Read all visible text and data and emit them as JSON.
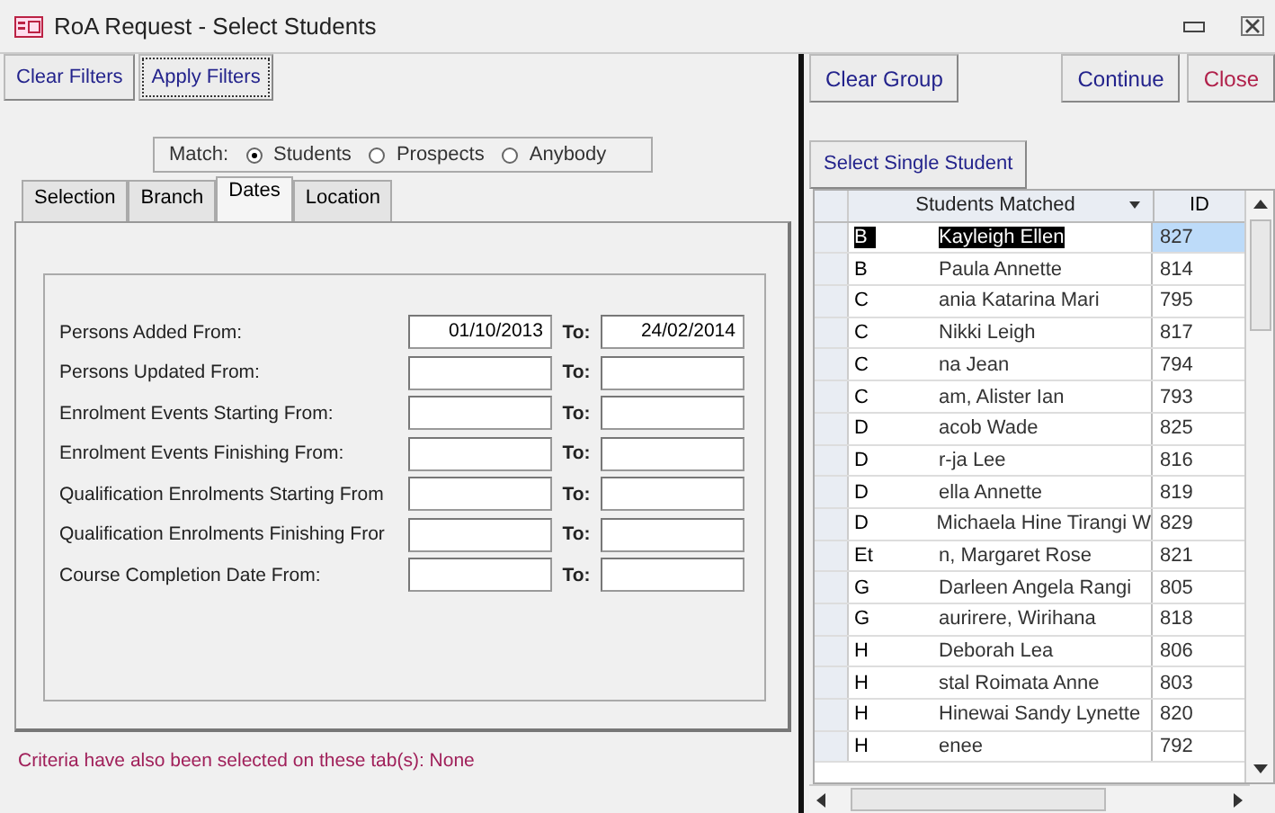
{
  "window": {
    "title": "RoA Request - Select Students"
  },
  "left_toolbar": [
    {
      "label": "Clear Filters",
      "focused": false
    },
    {
      "label": "Apply Filters",
      "focused": true
    }
  ],
  "match": {
    "label": "Match:",
    "options": [
      {
        "label": "Students",
        "selected": true
      },
      {
        "label": "Prospects",
        "selected": false
      },
      {
        "label": "Anybody",
        "selected": false
      }
    ]
  },
  "tabs": [
    {
      "label": "Selection",
      "selected": false
    },
    {
      "label": "Branch",
      "selected": false
    },
    {
      "label": "Dates",
      "selected": true
    },
    {
      "label": "Location",
      "selected": false
    }
  ],
  "date_filters": [
    {
      "label": "Persons Added From:",
      "from": "01/10/2013",
      "to_label": "To:",
      "to": "24/02/2014"
    },
    {
      "label": "Persons Updated From:",
      "to_label": "To:"
    },
    {
      "label": "Enrolment Events Starting From:",
      "to_label": "To:"
    },
    {
      "label": "Enrolment Events Finishing From:",
      "to_label": "To:"
    },
    {
      "label": "Qualification Enrolments Starting From",
      "to_label": "To:"
    },
    {
      "label": "Qualification Enrolments Finishing Fror",
      "to_label": "To:"
    },
    {
      "label": "Course Completion Date From:",
      "to_label": "To:"
    }
  ],
  "criteria_note": "Criteria have also been selected on these tab(s): None",
  "right_toolbar": {
    "left": [
      "Clear Group"
    ],
    "right": [
      {
        "label": "Continue",
        "kind": "normal"
      },
      {
        "label": "Close",
        "kind": "danger"
      }
    ]
  },
  "select_single_button": "Select Single Student",
  "grid": {
    "columns": [
      "Students Matched",
      "ID"
    ],
    "rows": [
      {
        "name_start": "B",
        "name_end": "Kayleigh Ellen",
        "id": "827",
        "selected": true
      },
      {
        "name_start": "B",
        "name_end": "Paula Annette",
        "id": "814",
        "selected": false
      },
      {
        "name_start": "C",
        "name_end": "ania Katarina Mari",
        "id": "795",
        "selected": false
      },
      {
        "name_start": "C",
        "name_end": "Nikki Leigh",
        "id": "817",
        "selected": false
      },
      {
        "name_start": "C",
        "name_end": "na Jean",
        "id": "794",
        "selected": false
      },
      {
        "name_start": "C",
        "name_end": "am, Alister Ian",
        "id": "793",
        "selected": false
      },
      {
        "name_start": "D",
        "name_end": "acob Wade",
        "id": "825",
        "selected": false
      },
      {
        "name_start": "D",
        "name_end": "r-ja Lee",
        "id": "816",
        "selected": false
      },
      {
        "name_start": "D",
        "name_end": "ella Annette",
        "id": "819",
        "selected": false
      },
      {
        "name_start": "D",
        "name_end": "Michaela Hine Tirangi W",
        "id": "829",
        "selected": false
      },
      {
        "name_start": "Et",
        "name_end": "n, Margaret Rose",
        "id": "821",
        "selected": false
      },
      {
        "name_start": "G",
        "name_end": "Darleen Angela Rangi",
        "id": "805",
        "selected": false
      },
      {
        "name_start": "G",
        "name_end": "aurirere, Wirihana",
        "id": "818",
        "selected": false
      },
      {
        "name_start": "H",
        "name_end": "Deborah Lea",
        "id": "806",
        "selected": false
      },
      {
        "name_start": "H",
        "name_end": "stal Roimata Anne",
        "id": "803",
        "selected": false
      },
      {
        "name_start": "H",
        "name_end": "Hinewai Sandy Lynette",
        "id": "820",
        "selected": false
      },
      {
        "name_start": "H",
        "name_end": "enee",
        "id": "792",
        "selected": false
      }
    ]
  }
}
